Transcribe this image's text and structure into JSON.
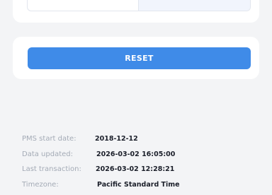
{
  "colors": {
    "background": "#f3f4f6",
    "card": "#ffffff",
    "primary_button": "#3f8be8",
    "label_text": "#a4abb6",
    "value_text": "#1b1f2a"
  },
  "reset": {
    "label": "RESET"
  },
  "info": [
    {
      "label": "PMS start date:",
      "value": "2018-12-12"
    },
    {
      "label": "Data updated:",
      "value": "2026-03-02 16:05:00"
    },
    {
      "label": "Last transaction:",
      "value": "2026-03-02 12:28:21"
    },
    {
      "label": "Timezone:",
      "value": "Pacific Standard Time"
    }
  ]
}
